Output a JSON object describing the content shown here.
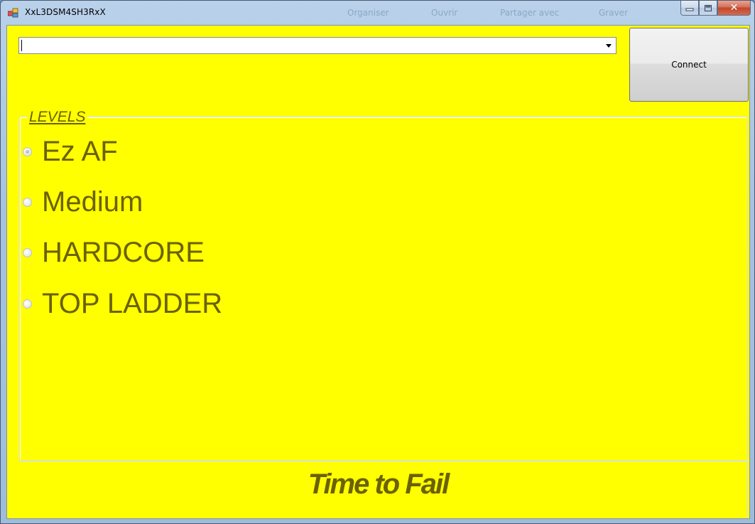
{
  "window": {
    "title": "XxL3DSM4SH3RxX"
  },
  "background_ghosts": [
    "Organiser",
    "Ouvrir",
    "Partager avec",
    "Graver"
  ],
  "caption": {
    "minimize_icon": "minimize-icon",
    "maximize_icon": "maximize-icon",
    "close_icon": "close-icon",
    "close_glyph": "✕"
  },
  "connection": {
    "combo_value": "",
    "connect_label": "Connect"
  },
  "levels": {
    "legend": "LEVELS",
    "options": [
      {
        "label": "Ez AF",
        "checked": true
      },
      {
        "label": "Medium",
        "checked": false
      },
      {
        "label": "HARDCORE",
        "checked": false
      },
      {
        "label": "TOP LADDER",
        "checked": false
      }
    ]
  },
  "footer": {
    "text": "Time to Fail"
  },
  "colors": {
    "client_background": "#ffff00",
    "text_olive": "#6a6200"
  }
}
